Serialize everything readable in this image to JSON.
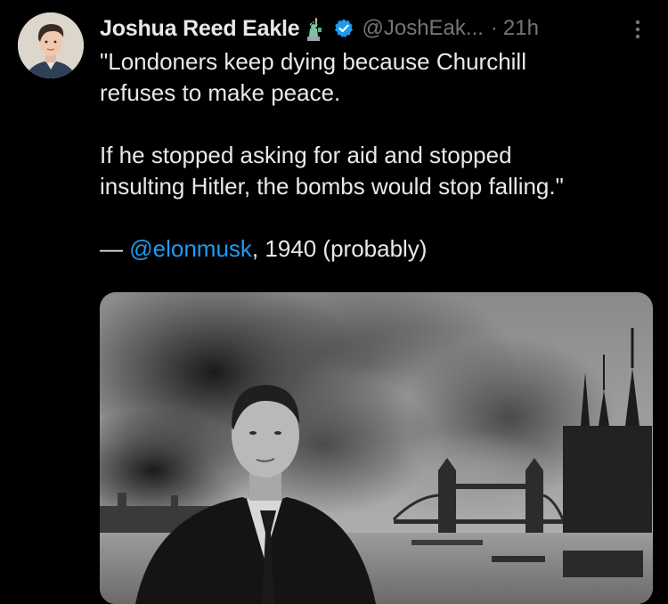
{
  "tweet": {
    "display_name": "Joshua Reed Eakle",
    "handle": "@JoshEak...",
    "separator": "·",
    "time": "21h",
    "text": {
      "line1": "\"Londoners keep dying because Churchill",
      "line2": "refuses to make peace.",
      "line3": "If he stopped asking for aid and stopped",
      "line4": "insulting Hitler, the bombs would stop falling.\"",
      "attribution_dash": "— ",
      "attribution_mention": "@elonmusk",
      "attribution_rest": ", 1940 (probably)"
    }
  },
  "icons": {
    "avatar": "profile-photo",
    "emoji": "statue-of-liberty-icon",
    "verified": "verified-badge-icon",
    "more": "more-vertical-icon"
  },
  "colors": {
    "background": "#000000",
    "text": "#e7e9ea",
    "secondary": "#71767b",
    "link": "#1d9bf0",
    "verified": "#1d9bf0"
  }
}
